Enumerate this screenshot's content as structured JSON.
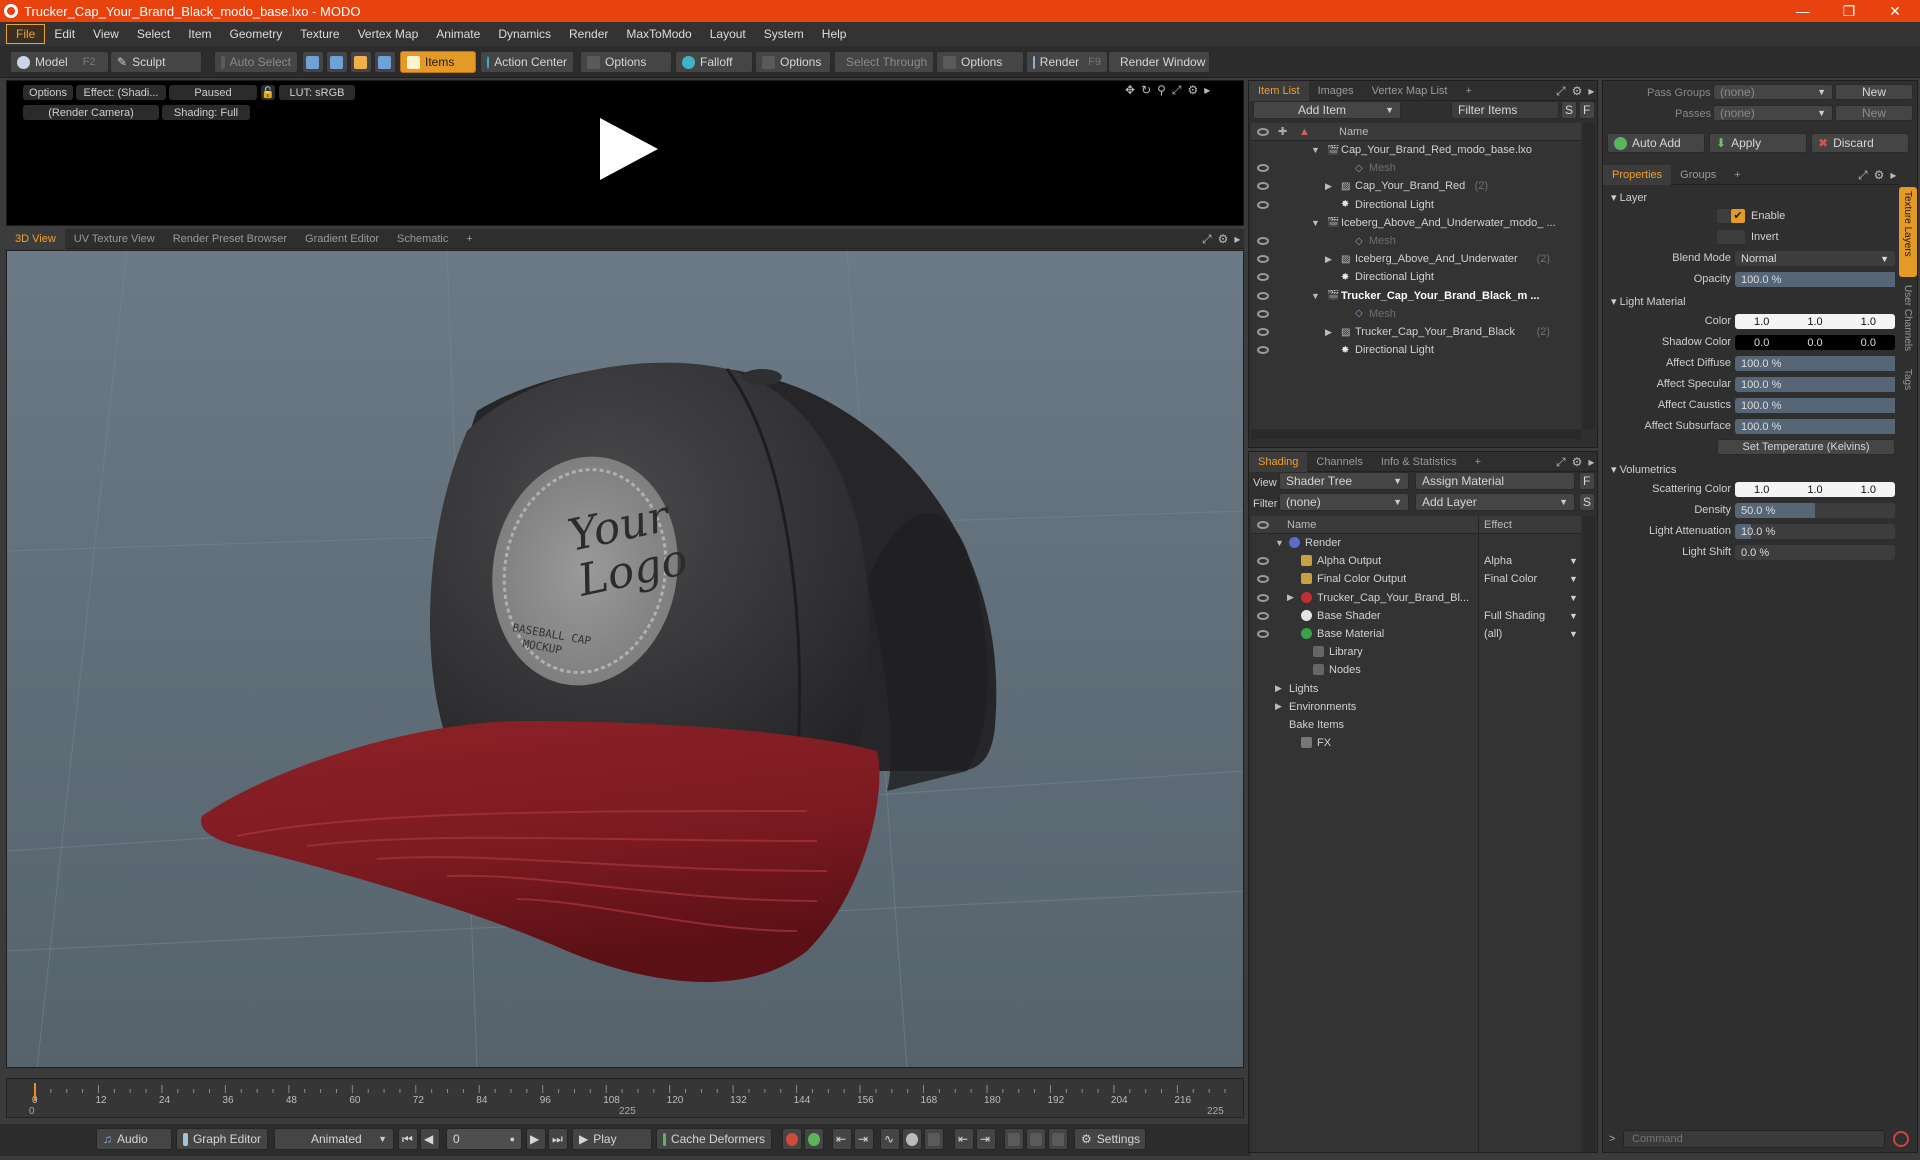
{
  "window": {
    "title": "Trucker_Cap_Your_Brand_Black_modo_base.lxo - MODO"
  },
  "menu": [
    "File",
    "Edit",
    "View",
    "Select",
    "Item",
    "Geometry",
    "Texture",
    "Vertex Map",
    "Animate",
    "Dynamics",
    "Render",
    "MaxToModo",
    "Layout",
    "System",
    "Help"
  ],
  "toolbar": {
    "model": "Model",
    "model_key": "F2",
    "sculpt": "Sculpt",
    "auto_select": "Auto Select",
    "items": "Items",
    "action_center": "Action Center",
    "options1": "Options",
    "falloff": "Falloff",
    "options2": "Options",
    "select_through": "Select Through",
    "options3": "Options",
    "render": "Render",
    "render_key": "F9",
    "render_window": "Render Window"
  },
  "preview": {
    "options": "Options",
    "effect": "Effect: (Shadi...",
    "paused": "Paused",
    "lut": "LUT: sRGB",
    "camera": "(Render Camera)",
    "shading": "Shading: Full"
  },
  "viewport_tabs": [
    "3D View",
    "UV Texture View",
    "Render Preset Browser",
    "Gradient Editor",
    "Schematic",
    "+"
  ],
  "logo": {
    "line1": "Your",
    "line2": "Logo",
    "line3": "BASEBALL CAP",
    "line4": "MOCKUP"
  },
  "timeline": {
    "ticks": [
      "0",
      "12",
      "24",
      "36",
      "48",
      "60",
      "72",
      "84",
      "96",
      "108",
      "120",
      "132",
      "144",
      "156",
      "168",
      "180",
      "192",
      "204",
      "216"
    ],
    "range_start": "0",
    "range_mid": "225",
    "range_end": "225"
  },
  "bottom": {
    "audio": "Audio",
    "graph_editor": "Graph Editor",
    "animated": "Animated",
    "frame": "0",
    "play": "Play",
    "cache_deformers": "Cache Deformers",
    "settings": "Settings"
  },
  "itemlist": {
    "tabs": [
      "Item List",
      "Images",
      "Vertex Map List",
      "+"
    ],
    "add_item": "Add Item",
    "filter_items": "Filter Items",
    "s": "S",
    "f": "F",
    "name_header": "Name",
    "rows": [
      {
        "label": "Cap_Your_Brand_Red_modo_base.lxo",
        "count": "",
        "level": 0,
        "kind": "scene",
        "eye": false,
        "expand": "down"
      },
      {
        "label": "Mesh",
        "count": "",
        "level": 2,
        "kind": "mesh",
        "eye": true,
        "expand": ""
      },
      {
        "label": "Cap_Your_Brand_Red",
        "count": "(2)",
        "level": 1,
        "kind": "group",
        "eye": true,
        "expand": "right"
      },
      {
        "label": "Directional Light",
        "count": "",
        "level": 1,
        "kind": "light",
        "eye": true,
        "expand": ""
      },
      {
        "label": "Iceberg_Above_And_Underwater_modo_ ...",
        "count": "",
        "level": 0,
        "kind": "scene",
        "eye": false,
        "expand": "down"
      },
      {
        "label": "Mesh",
        "count": "",
        "level": 2,
        "kind": "mesh",
        "eye": true,
        "expand": ""
      },
      {
        "label": "Iceberg_Above_And_Underwater",
        "count": "(2)",
        "level": 1,
        "kind": "group",
        "eye": true,
        "expand": "right"
      },
      {
        "label": "Directional Light",
        "count": "",
        "level": 1,
        "kind": "light",
        "eye": true,
        "expand": ""
      },
      {
        "label": "Trucker_Cap_Your_Brand_Black_m ...",
        "count": "",
        "level": 0,
        "kind": "scene-bold",
        "eye": true,
        "expand": "down"
      },
      {
        "label": "Mesh",
        "count": "",
        "level": 2,
        "kind": "mesh",
        "eye": true,
        "expand": ""
      },
      {
        "label": "Trucker_Cap_Your_Brand_Black",
        "count": "(2)",
        "level": 1,
        "kind": "group",
        "eye": true,
        "expand": "right"
      },
      {
        "label": "Directional Light",
        "count": "",
        "level": 1,
        "kind": "light",
        "eye": true,
        "expand": ""
      }
    ]
  },
  "shading": {
    "tabs": [
      "Shading",
      "Channels",
      "Info & Statistics",
      "+"
    ],
    "view_label": "View",
    "view_value": "Shader Tree",
    "assign_material": "Assign Material",
    "f": "F",
    "filter_label": "Filter",
    "filter_value": "(none)",
    "add_layer": "Add Layer",
    "s": "S",
    "name_header": "Name",
    "effect_header": "Effect",
    "rows": [
      {
        "label": "Render",
        "effect": "",
        "level": 0,
        "icon": "render",
        "eye": false,
        "expand": "down"
      },
      {
        "label": "Alpha Output",
        "effect": "Alpha",
        "level": 1,
        "icon": "output",
        "eye": true,
        "expand": ""
      },
      {
        "label": "Final Color Output",
        "effect": "Final Color",
        "level": 1,
        "icon": "output",
        "eye": true,
        "expand": ""
      },
      {
        "label": "Trucker_Cap_Your_Brand_Bl...",
        "effect": "",
        "level": 1,
        "icon": "material-red",
        "eye": true,
        "expand": "right"
      },
      {
        "label": "Base Shader",
        "effect": "Full Shading",
        "level": 1,
        "icon": "shader",
        "eye": true,
        "expand": ""
      },
      {
        "label": "Base Material",
        "effect": "(all)",
        "level": 1,
        "icon": "material",
        "eye": true,
        "expand": ""
      },
      {
        "label": "Library",
        "effect": "",
        "level": 2,
        "icon": "folder",
        "eye": false,
        "expand": ""
      },
      {
        "label": "Nodes",
        "effect": "",
        "level": 2,
        "icon": "folder",
        "eye": false,
        "expand": ""
      },
      {
        "label": "Lights",
        "effect": "",
        "level": 0,
        "icon": "none",
        "eye": false,
        "expand": "right"
      },
      {
        "label": "Environments",
        "effect": "",
        "level": 0,
        "icon": "none",
        "eye": false,
        "expand": "right"
      },
      {
        "label": "Bake Items",
        "effect": "",
        "level": 0,
        "icon": "none",
        "eye": false,
        "expand": ""
      },
      {
        "label": "FX",
        "effect": "",
        "level": 1,
        "icon": "fx",
        "eye": false,
        "expand": ""
      }
    ]
  },
  "props": {
    "pass_groups_label": "Pass Groups",
    "pass_groups_value": "(none)",
    "new1": "New",
    "passes_label": "Passes",
    "passes_value": "(none)",
    "new2": "New",
    "auto_add": "Auto Add",
    "apply": "Apply",
    "discard": "Discard",
    "tabs": [
      "Properties",
      "Groups",
      "+"
    ],
    "side_tabs": [
      "Texture Layers",
      "User Channels",
      "Tags"
    ],
    "layer_section": "Layer",
    "enable": "Enable",
    "invert": "Invert",
    "blend_mode_label": "Blend Mode",
    "blend_mode": "Normal",
    "opacity_label": "Opacity",
    "opacity": "100.0 %",
    "light_material_section": "Light Material",
    "color_label": "Color",
    "color": [
      "1.0",
      "1.0",
      "1.0"
    ],
    "shadow_color_label": "Shadow Color",
    "shadow_color": [
      "0.0",
      "0.0",
      "0.0"
    ],
    "affect_diffuse_label": "Affect Diffuse",
    "affect_diffuse": "100.0 %",
    "affect_specular_label": "Affect Specular",
    "affect_specular": "100.0 %",
    "affect_caustics_label": "Affect Caustics",
    "affect_caustics": "100.0 %",
    "affect_subsurface_label": "Affect Subsurface",
    "affect_subsurface": "100.0 %",
    "set_temperature": "Set Temperature (Kelvins)",
    "volumetrics_section": "Volumetrics",
    "scattering_color_label": "Scattering Color",
    "scattering_color": [
      "1.0",
      "1.0",
      "1.0"
    ],
    "density_label": "Density",
    "density": "50.0 %",
    "light_attenuation_label": "Light Attenuation",
    "light_attenuation": "10.0 %",
    "light_shift_label": "Light Shift",
    "light_shift": "0.0 %",
    "command_placeholder": "Command"
  }
}
